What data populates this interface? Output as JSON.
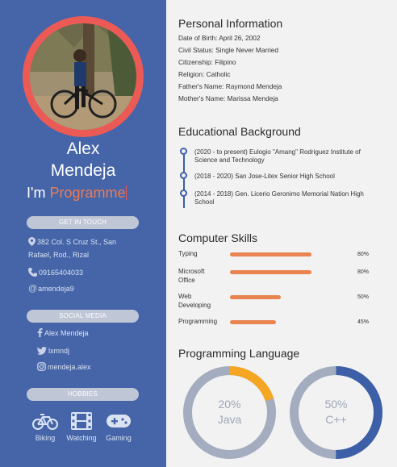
{
  "profile": {
    "first_name": "Alex",
    "last_name": "Mendeja",
    "role_prefix": "I'm",
    "role_typed": "Programme"
  },
  "contact": {
    "header": "GET IN TOUCH",
    "address_line1": "382 Col. S Cruz St., San",
    "address_line2": "Rafael, Rod., Rizal",
    "phone": "09165404033",
    "email": "amendeja9"
  },
  "social": {
    "header": "SOCIAL MEDIA",
    "facebook": "Alex Mendeja",
    "twitter": "lxmndj",
    "instagram": "mendeja.alex"
  },
  "hobbies": {
    "header": "HOBBIES",
    "items": [
      {
        "label": "Biking",
        "icon": "bicycle-icon"
      },
      {
        "label": "Watching",
        "icon": "film-icon"
      },
      {
        "label": "Gaming",
        "icon": "gamepad-icon"
      }
    ]
  },
  "personal": {
    "title": "Personal Information",
    "lines": [
      "Date of Birth: April 26, 2002",
      "Civil Status: Single Never Married",
      "Citizenship: Filipino",
      "Religion: Catholic",
      "Father's Name: Raymond Mendeja",
      "Mother's Name: Marissa Mendeja"
    ]
  },
  "education": {
    "title": "Educational Background",
    "items": [
      "(2020 - to present) Eulogio \"Amang\" Rodriguez Institute of Science and Technology",
      "(2018 - 2020) San Jose-Litex Senior High School",
      "(2014 - 2018) Gen. Licerio Geronimo Memorial Nation High School"
    ]
  },
  "skills": {
    "title": "Computer Skills",
    "items": [
      {
        "label": "Typing",
        "pct_label": "80%",
        "value": 0.8
      },
      {
        "label": "Microsoft Office",
        "pct_label": "80%",
        "value": 0.8
      },
      {
        "label": "Web Developing",
        "pct_label": "50%",
        "value": 0.5
      },
      {
        "label": "Programming",
        "pct_label": "45%",
        "value": 0.45
      }
    ]
  },
  "programming": {
    "title": "Programming Language",
    "items": [
      {
        "pct_label": "20%",
        "lang": "Java",
        "value": 0.2,
        "color": "#f5a623"
      },
      {
        "pct_label": "50%",
        "lang": "C++",
        "value": 0.5,
        "color": "#3c5fa8"
      }
    ]
  },
  "colors": {
    "sidebar": "#4565a8",
    "accent": "#ec5a55",
    "skill_bar": "#e9834f"
  }
}
